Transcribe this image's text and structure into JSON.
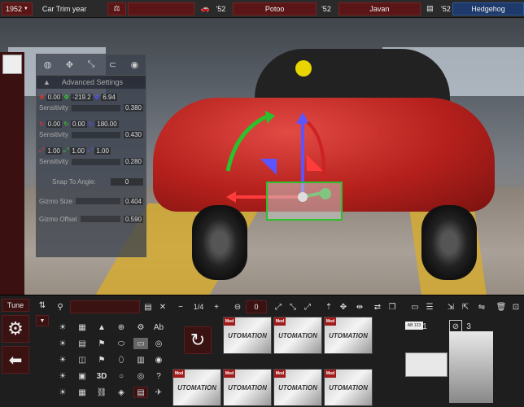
{
  "topbar": {
    "year": "1952",
    "year_caret": "▼",
    "trim_label": "Car Trim year",
    "car1_year": "'52",
    "car1_name": "Potoo",
    "car2_year": "'52",
    "car2_name": "Javan",
    "car3_year": "'52",
    "car3_name": "Hedgehog"
  },
  "gizmo": {
    "header": "Advanced Settings",
    "pos": [
      "0.00",
      "-219.2",
      "6.94"
    ],
    "pos_sens_label": "Sensitivity",
    "pos_sens": "0.380",
    "rot": [
      "0.00",
      "0.00",
      "180.00"
    ],
    "rot_sens_label": "Sensitivity",
    "rot_sens": "0.430",
    "scale": [
      "1.00",
      "1.00",
      "1.00"
    ],
    "scale_sens_label": "Sensitivity",
    "scale_sens": "0.280",
    "snap_label": "Snap To Angle:",
    "snap_value": "0",
    "size_label": "Gizmo Size",
    "size_value": "0.404",
    "offset_label": "Gizmo Offset",
    "offset_value": "0.590"
  },
  "bottom": {
    "tune_label": "Tune",
    "page_indicator": "1/4",
    "counter_value": "0",
    "sym_ab": "Ab",
    "sym_3d": "3D",
    "slot1_badge": "AB 123",
    "slot1_num": "1",
    "slot3_num": "3",
    "tile_text": "UTOMATION",
    "mod_badge": "Mod"
  },
  "colors": {
    "accent_red": "#7a2222",
    "accent_blue": "#2e5aa0"
  }
}
